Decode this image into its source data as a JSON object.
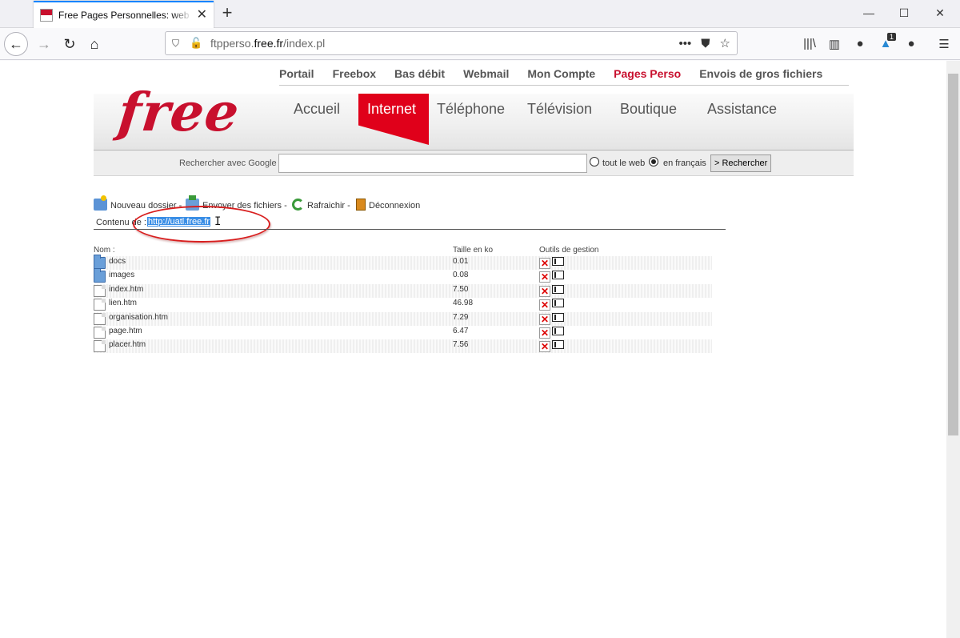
{
  "browser": {
    "tab_title": "Free Pages Personnelles: web ftp",
    "url_host": "ftpperso.",
    "url_domain": "free.fr",
    "url_path": "/index.pl",
    "extension_badge": "1",
    "icons": [
      "back-icon",
      "forward-icon",
      "reload-icon",
      "home-icon",
      "shield-icon",
      "insecure-lock-icon",
      "more-icon",
      "pocket-icon",
      "bookmark-star-icon",
      "library-icon",
      "sidebar-icon",
      "account-icon",
      "extension-icon",
      "menu-icon"
    ]
  },
  "top_links": [
    "Portail",
    "Freebox",
    "Bas débit",
    "Webmail",
    "Mon Compte",
    "Pages Perso",
    "Envois de gros fichiers"
  ],
  "logo_text": "free",
  "main_nav": {
    "accueil": "Accueil",
    "internet": "Internet",
    "telephone": "Téléphone",
    "television": "Télévision",
    "boutique": "Boutique",
    "assistance": "Assistance"
  },
  "search": {
    "label": "Rechercher avec Google",
    "value": "",
    "option_web": "tout le web",
    "option_fr": "en français",
    "selected": "en français",
    "button": "> Rechercher"
  },
  "actions": {
    "new_folder": "Nouveau dossier",
    "upload": "Envoyer des fichiers",
    "refresh": "Rafraichir",
    "logout": "Déconnexion",
    "separator": "-"
  },
  "content": {
    "label": "Contenu de :",
    "url": "http://uatl.free.fr"
  },
  "file_table": {
    "headers": {
      "name": "Nom :",
      "size": "Taille en ko",
      "tools": "Outils de gestion"
    },
    "rows": [
      {
        "name": "docs",
        "size": "0.01",
        "type": "folder"
      },
      {
        "name": "images",
        "size": "0.08",
        "type": "folder"
      },
      {
        "name": "index.htm",
        "size": "7.50",
        "type": "file"
      },
      {
        "name": "lien.htm",
        "size": "46.98",
        "type": "file"
      },
      {
        "name": "organisation.htm",
        "size": "7.29",
        "type": "file"
      },
      {
        "name": "page.htm",
        "size": "6.47",
        "type": "file"
      },
      {
        "name": "placer.htm",
        "size": "7.56",
        "type": "file"
      }
    ]
  },
  "colors": {
    "brand_red": "#c8102e",
    "internet_tab": "#e0001a",
    "selection": "#3a8ee6",
    "highlight_circle": "#d81e1e"
  }
}
